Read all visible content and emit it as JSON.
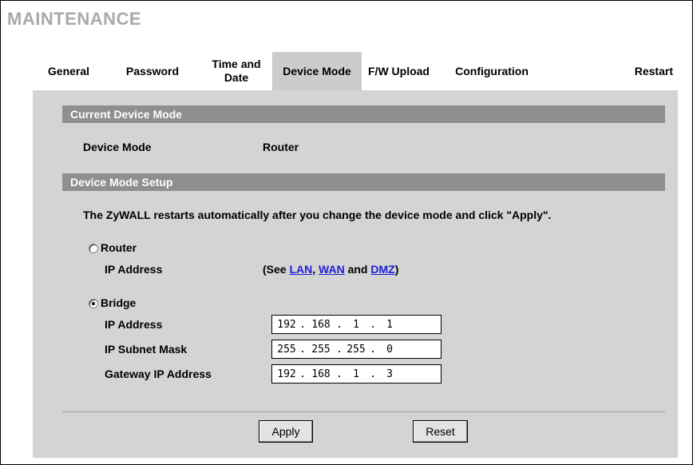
{
  "page": {
    "title": "MAINTENANCE"
  },
  "tabs": [
    {
      "label": "General"
    },
    {
      "label": "Password"
    },
    {
      "label": "Time and Date"
    },
    {
      "label": "Device Mode",
      "active": true
    },
    {
      "label": "F/W Upload"
    },
    {
      "label": "Configuration"
    },
    {
      "label": "Restart"
    }
  ],
  "current": {
    "section_title": "Current Device Mode",
    "mode_label": "Device Mode",
    "mode_value": "Router"
  },
  "setup": {
    "section_title": "Device Mode Setup",
    "notice": "The ZyWALL restarts automatically after you change the device mode and click \"Apply\".",
    "router": {
      "label": "Router",
      "selected": false,
      "ip_label": "IP Address",
      "see_prefix": "(See ",
      "lan_link": "LAN",
      "comma": ", ",
      "wan_link": "WAN",
      "and_text": " and ",
      "dmz_link": "DMZ",
      "see_suffix": ")"
    },
    "bridge": {
      "label": "Bridge",
      "selected": true,
      "ip_label": "IP Address",
      "ip": [
        "192",
        "168",
        "1",
        "1"
      ],
      "mask_label": "IP Subnet Mask",
      "mask": [
        "255",
        "255",
        "255",
        "0"
      ],
      "gw_label": "Gateway IP Address",
      "gw": [
        "192",
        "168",
        "1",
        "3"
      ]
    }
  },
  "buttons": {
    "apply": "Apply",
    "reset": "Reset"
  }
}
